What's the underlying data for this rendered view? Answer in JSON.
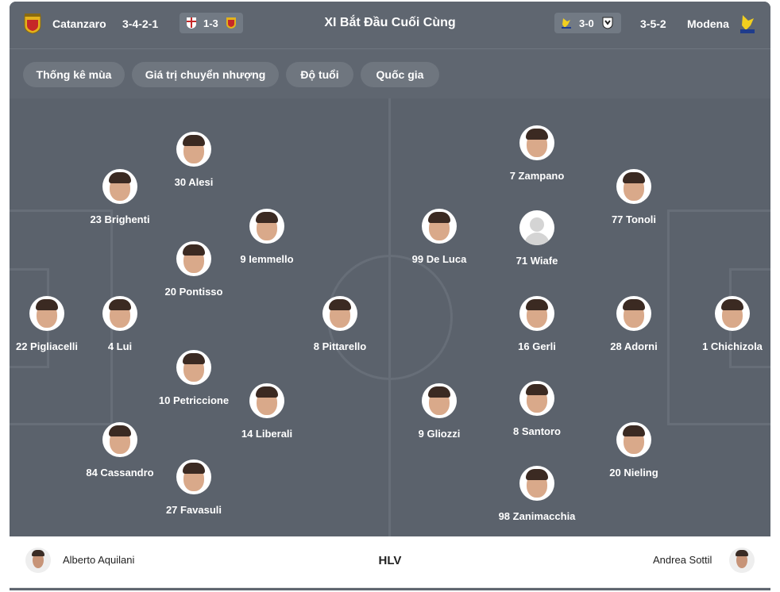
{
  "header": {
    "title": "XI Bắt Đầu Cuối Cùng",
    "home": {
      "name": "Catanzaro",
      "formation": "3-4-2-1",
      "last_score": "1-3"
    },
    "away": {
      "name": "Modena",
      "formation": "3-5-2",
      "last_score": "3-0"
    },
    "colors": {
      "catanzaro": "#e3b21c",
      "catanzaro_red": "#c62828",
      "modena": "#f2cf1f",
      "modena_blue": "#1f3c8c"
    }
  },
  "tabs": [
    "Thống kê mùa",
    "Giá trị chuyển nhượng",
    "Độ tuổi",
    "Quốc gia"
  ],
  "home_players": [
    {
      "label": "30 Alesi"
    },
    {
      "label": "23 Brighenti"
    },
    {
      "label": "9 Iemmello"
    },
    {
      "label": "20 Pontisso"
    },
    {
      "label": "22 Pigliacelli"
    },
    {
      "label": "4 Lui"
    },
    {
      "label": "8 Pittarello"
    },
    {
      "label": "10 Petriccione"
    },
    {
      "label": "14 Liberali"
    },
    {
      "label": "84 Cassandro"
    },
    {
      "label": "27 Favasuli"
    }
  ],
  "away_players": [
    {
      "label": "7 Zampano"
    },
    {
      "label": "77 Tonoli"
    },
    {
      "label": "99 De Luca"
    },
    {
      "label": "71 Wiafe"
    },
    {
      "label": "16 Gerli"
    },
    {
      "label": "28 Adorni"
    },
    {
      "label": "1 Chichizola"
    },
    {
      "label": "9 Gliozzi"
    },
    {
      "label": "8 Santoro"
    },
    {
      "label": "20 Nieling"
    },
    {
      "label": "98 Zanimacchia"
    }
  ],
  "footer": {
    "home_coach": "Alberto Aquilani",
    "label": "HLV",
    "away_coach": "Andrea Sottil"
  }
}
